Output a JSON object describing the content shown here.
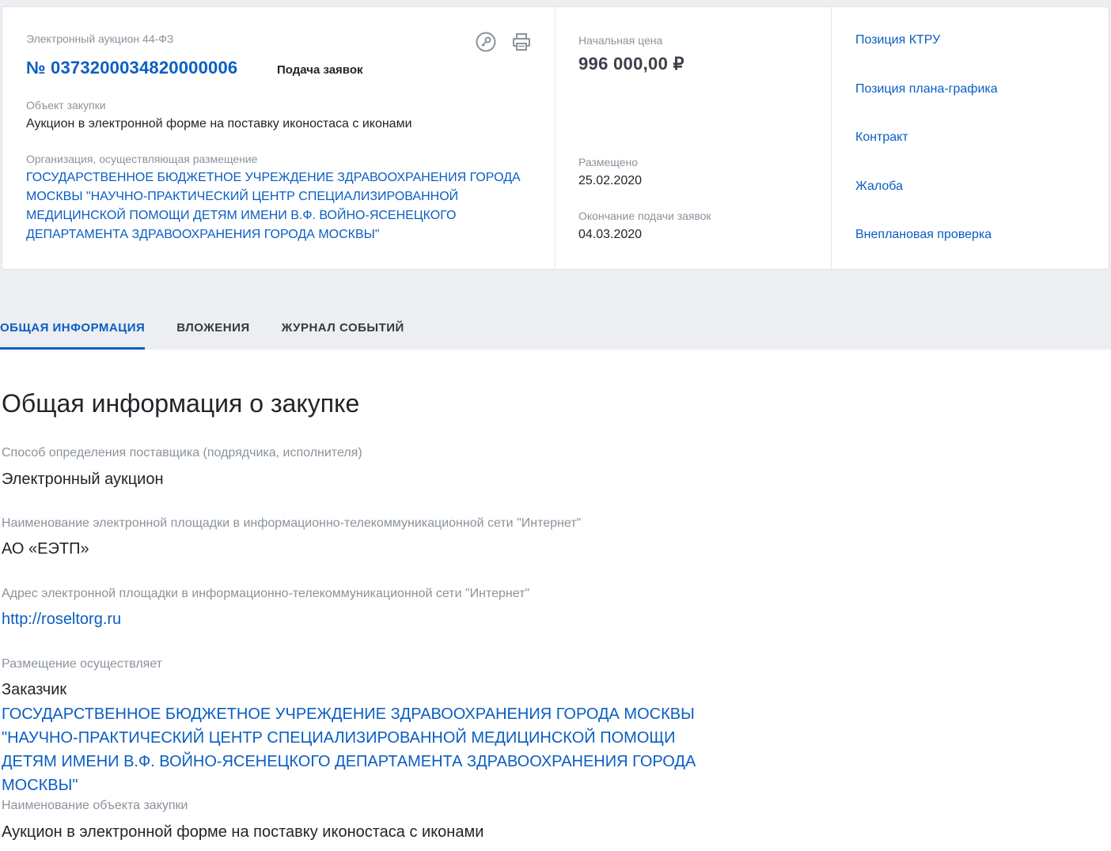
{
  "header": {
    "procedure_type": "Электронный аукцион 44-ФЗ",
    "reg_number": "№ 0373200034820000006",
    "status": "Подача заявок",
    "object_label": "Объект закупки",
    "object_value": "Аукцион в электронной форме на поставку иконостаса с иконами",
    "org_label": "Организация, осуществляющая размещение",
    "org_value": "ГОСУДАРСТВЕННОЕ БЮДЖЕТНОЕ УЧРЕЖДЕНИЕ ЗДРАВООХРАНЕНИЯ ГОРОДА МОСКВЫ \"НАУЧНО-ПРАКТИЧЕСКИЙ ЦЕНТР СПЕЦИАЛИЗИРОВАННОЙ МЕДИЦИНСКОЙ ПОМОЩИ ДЕТЯМ ИМЕНИ В.Ф. ВОЙНО-ЯСЕНЕЦКОГО ДЕПАРТАМЕНТА ЗДРАВООХРАНЕНИЯ ГОРОДА МОСКВЫ\"",
    "icons": [
      "key-icon",
      "print-icon"
    ]
  },
  "price": {
    "label": "Начальная цена",
    "value": "996 000,00 ₽",
    "posted_label": "Размещено",
    "posted_value": "25.02.2020",
    "deadline_label": "Окончание подачи заявок",
    "deadline_value": "04.03.2020"
  },
  "links": [
    {
      "label": "Позиция КТРУ"
    },
    {
      "label": "Позиция плана-графика"
    },
    {
      "label": "Контракт"
    },
    {
      "label": "Жалоба"
    },
    {
      "label": "Внеплановая проверка"
    }
  ],
  "tabs": [
    {
      "label": "ОБЩАЯ ИНФОРМАЦИЯ",
      "active": true
    },
    {
      "label": "ВЛОЖЕНИЯ",
      "active": false
    },
    {
      "label": "ЖУРНАЛ СОБЫТИЙ",
      "active": false
    }
  ],
  "main": {
    "title": "Общая информация о закупке",
    "fields": [
      {
        "label": "Способ определения поставщика (подрядчика, исполнителя)",
        "value": "Электронный аукцион"
      },
      {
        "label": "Наименование электронной площадки в информационно-телекоммуникационной сети \"Интернет\"",
        "value": "АО «ЕЭТП»"
      },
      {
        "label": "Адрес электронной площадки в информационно-телекоммуникационной сети \"Интернет\"",
        "value": "http://roseltorg.ru"
      },
      {
        "label": "Размещение осуществляет",
        "value": "Заказчик"
      },
      {
        "label": "Наименование объекта закупки",
        "value": "Аукцион в электронной форме на поставку иконостаса с иконами"
      }
    ],
    "placer_org": "ГОСУДАРСТВЕННОЕ БЮДЖЕТНОЕ УЧРЕЖДЕНИЕ ЗДРАВООХРАНЕНИЯ ГОРОДА МОСКВЫ \"НАУЧНО-ПРАКТИЧЕСКИЙ ЦЕНТР СПЕЦИАЛИЗИРОВАННОЙ МЕДИЦИНСКОЙ ПОМОЩИ ДЕТЯМ ИМЕНИ В.Ф. ВОЙНО-ЯСЕНЕЦКОГО ДЕПАРТАМЕНТА ЗДРАВООХРАНЕНИЯ ГОРОДА МОСКВЫ\""
  },
  "colors": {
    "accent": "#0a5ec2",
    "muted": "#8a939c",
    "background": "#eceef1"
  }
}
